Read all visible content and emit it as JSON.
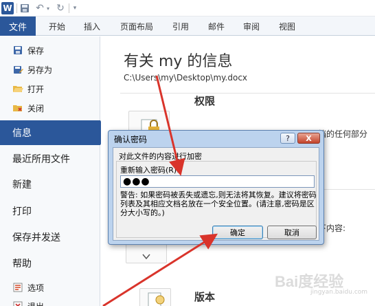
{
  "qat": {
    "app_logo": "W",
    "icons": [
      "save-icon",
      "undo-icon",
      "redo-icon",
      "customize-icon"
    ]
  },
  "ribbon": {
    "tabs": [
      {
        "id": "file",
        "label": "文件"
      },
      {
        "id": "home",
        "label": "开始"
      },
      {
        "id": "insert",
        "label": "插入"
      },
      {
        "id": "layout",
        "label": "页面布局"
      },
      {
        "id": "references",
        "label": "引用"
      },
      {
        "id": "mailings",
        "label": "邮件"
      },
      {
        "id": "review",
        "label": "审阅"
      },
      {
        "id": "view",
        "label": "视图"
      }
    ],
    "accent": "#2b579a"
  },
  "backstage": {
    "commands": {
      "save": "保存",
      "save_as": "另存为",
      "open": "打开",
      "close": "关闭"
    },
    "nav": {
      "info": "信息",
      "recent": "最近所用文件",
      "new": "新建",
      "print": "打印",
      "save_send": "保存并发送",
      "help": "帮助",
      "options": "选项",
      "exit": "退出"
    }
  },
  "main": {
    "title": "有关 my 的信息",
    "path": "C:\\Users\\my\\Desktop\\my.docx",
    "permissions_heading": "权限",
    "permissions_desc_partial": "档的任何部分",
    "inspect_desc_partial": "下内容:",
    "versions_heading": "版本"
  },
  "dialog": {
    "title": "确认密码",
    "help_label": "?",
    "close_label": "X",
    "encrypt_label": "对此文件的内容进行加密",
    "reenter_label": "重新输入密码(R):",
    "password_mask": "●●●",
    "warning": "警告: 如果密码被丢失或遗忘,则无法将其恢复。建议将密码列表及其相应文档名放在一个安全位置。(请注意,密码是区分大小写的。)",
    "ok_label": "确定",
    "cancel_label": "取消"
  },
  "annotations": {
    "arrow_color": "#d9342b"
  }
}
